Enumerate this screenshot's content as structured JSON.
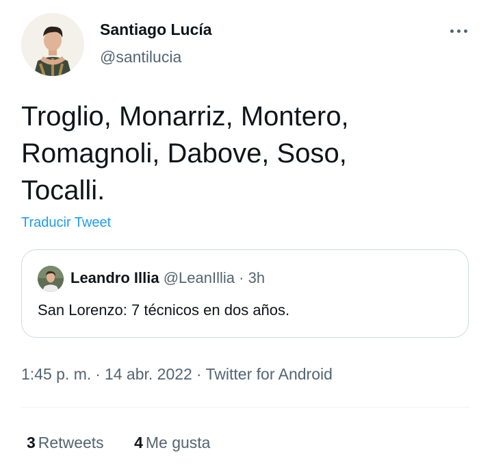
{
  "author": {
    "name": "Santiago Lucía",
    "handle": "@santilucia",
    "avatar_icon": "user-avatar"
  },
  "more_icon": "more-horizontal-icon",
  "tweet": {
    "lines": [
      "Troglio, Monarriz, Montero,",
      "Romagnoli, Dabove, Soso,",
      "Tocalli."
    ]
  },
  "translate_label": "Traducir Tweet",
  "quoted_tweet": {
    "name": "Leandro Illia",
    "handle": "@LeanIllia",
    "separator": "·",
    "time": "3h",
    "text": "San Lorenzo: 7 técnicos en dos años."
  },
  "meta": {
    "time": "1:45 p. m.",
    "separator": "·",
    "date": "14 abr. 2022",
    "source": "Twitter for Android"
  },
  "stats": {
    "retweets_count": "3",
    "retweets_label": "Retweets",
    "likes_count": "4",
    "likes_label": "Me gusta"
  },
  "colors": {
    "link": "#1d9bf0",
    "text": "#0f1419",
    "secondary": "#536471",
    "border": "#cfd9de"
  }
}
